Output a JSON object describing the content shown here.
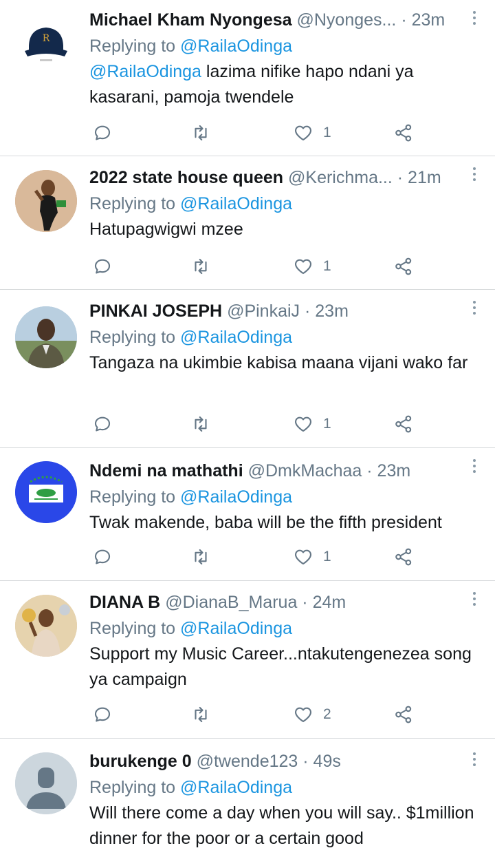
{
  "tweets": [
    {
      "name": "Michael Kham Nyongesa",
      "handle": "@Nyonges...",
      "time": "· 23m",
      "replying_prefix": "Replying to ",
      "replying_to": "@RailaOdinga",
      "text_mention": "@RailaOdinga",
      "text": " lazima nifike hapo ndani ya kasarani, pamoja twendele",
      "likes": "1",
      "avatar": "cap-logo"
    },
    {
      "name": "2022 state house queen",
      "handle": "@Kerichma...",
      "time": "· 21m",
      "replying_prefix": "Replying to ",
      "replying_to": "@RailaOdinga",
      "text": "Hatupagwigwi mzee",
      "likes": "1",
      "avatar": "woman-photo"
    },
    {
      "name": "PINKAI JOSEPH",
      "handle": "@PinkaiJ",
      "time": "· 23m",
      "replying_prefix": "Replying to ",
      "replying_to": "@RailaOdinga",
      "text": "Tangaza na ukimbie kabisa maana vijani wako far",
      "likes": "1",
      "avatar": "man-photo"
    },
    {
      "name": "Ndemi na mathathi",
      "handle": "@DmkMachaa",
      "time": "· 23m",
      "replying_prefix": "Replying to ",
      "replying_to": "@RailaOdinga",
      "text": "Twak makende, baba will be the fifth president",
      "likes": "1",
      "avatar": "blue-logo"
    },
    {
      "name": "DIANA B",
      "handle": "@DianaB_Marua",
      "time": "· 24m",
      "replying_prefix": "Replying to ",
      "replying_to": "@RailaOdinga",
      "text": "Support my Music Career...ntakutengenezea song ya campaign",
      "likes": "2",
      "avatar": "woman-photo-2"
    },
    {
      "name": "burukenge 0",
      "handle": "@twende123",
      "time": "· 49s",
      "replying_prefix": "Replying to ",
      "replying_to": "@RailaOdinga",
      "text": "Will there come a day when you will say.. $1million dinner for the poor or a certain good",
      "avatar": "default-avatar"
    }
  ],
  "colors": {
    "link": "#1b95e0",
    "secondary": "#657786",
    "divider": "#d6d9db"
  },
  "icons": [
    "reply-icon",
    "retweet-icon",
    "like-icon",
    "share-icon",
    "more-icon"
  ]
}
